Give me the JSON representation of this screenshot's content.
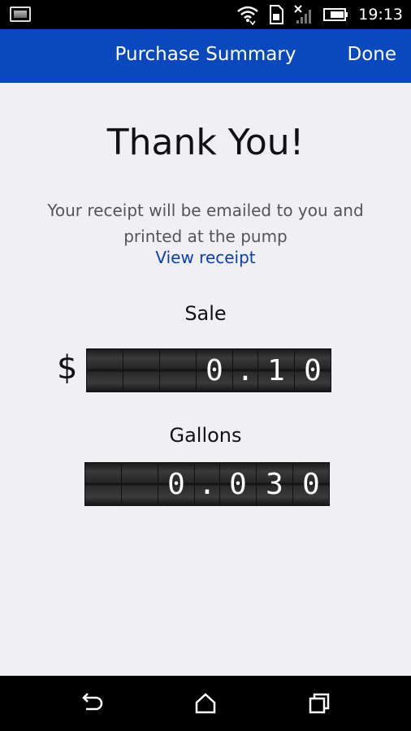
{
  "status_bar": {
    "time": "19:13",
    "icons": [
      "image-notification-icon",
      "wifi-icon",
      "sim-card-icon",
      "signal-off-icon",
      "battery-icon"
    ]
  },
  "app_bar": {
    "title": "Purchase Summary",
    "done_label": "Done",
    "color": "#0a48be"
  },
  "content": {
    "heading": "Thank You!",
    "message": "Your receipt will be emailed to you and printed at the pump",
    "view_receipt_label": "View receipt",
    "link_color": "#0a3fb0"
  },
  "sale": {
    "label": "Sale",
    "currency": "$",
    "digits": [
      "",
      "",
      "",
      "0",
      ".",
      "1",
      "0"
    ]
  },
  "gallons": {
    "label": "Gallons",
    "digits": [
      "",
      "",
      "0",
      ".",
      "0",
      "3",
      "0"
    ]
  },
  "nav_bar": {
    "buttons": [
      "back-icon",
      "home-icon",
      "recent-apps-icon"
    ]
  }
}
